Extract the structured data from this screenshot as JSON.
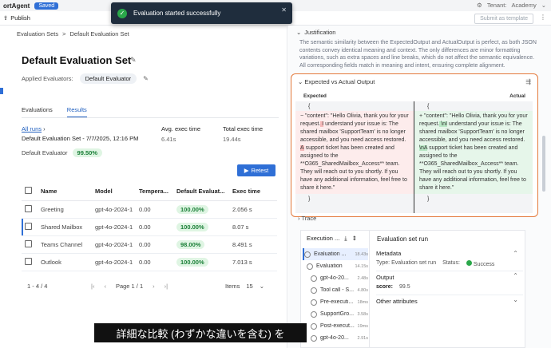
{
  "topbar": {
    "app": "ortAgent",
    "saved": "Saved",
    "tenant": "Tenant:",
    "tenant_name": "Academy"
  },
  "toolbar": {
    "publish": "Publish",
    "submit_template": "Submit as template"
  },
  "toast": {
    "message": "Evaluation started successfully"
  },
  "breadcrumb": {
    "root": "Evaluation Sets",
    "sep": ">",
    "current": "Default Evaluation Set"
  },
  "page": {
    "title": "Default Evaluation Set",
    "applied_label": "Applied Evaluators:",
    "evaluator_chip": "Default Evaluator"
  },
  "tabs": [
    {
      "label": "Evaluations"
    },
    {
      "label": "Results"
    }
  ],
  "run": {
    "all_runs": "All runs",
    "run_name": "Default Evaluation Set - 7/7/2025, 12:16 PM",
    "avg_label": "Avg. exec time",
    "avg_value": "6.41s",
    "total_label": "Total exec time",
    "total_value": "19.44s",
    "evaluator_label": "Default Evaluator",
    "evaluator_score": "99.50%"
  },
  "retest_label": "Retest",
  "table": {
    "headers": [
      "Name",
      "Model",
      "Tempera...",
      "Default Evaluat...",
      "Exec time"
    ],
    "rows": [
      {
        "name": "Greeting",
        "model": "gpt-4o-2024-1",
        "temp": "0.00",
        "score": "100.00%",
        "time": "2.056 s"
      },
      {
        "name": "Shared Mailbox",
        "model": "gpt-4o-2024-1",
        "temp": "0.00",
        "score": "100.00%",
        "time": "8.07 s"
      },
      {
        "name": "Teams Channel",
        "model": "gpt-4o-2024-1",
        "temp": "0.00",
        "score": "98.00%",
        "time": "8.491 s"
      },
      {
        "name": "Outlook",
        "model": "gpt-4o-2024-1",
        "temp": "0.00",
        "score": "100.00%",
        "time": "7.013 s"
      }
    ]
  },
  "pager": {
    "count": "1 - 4 / 4",
    "page": "Page 1 / 1",
    "items_label": "Items",
    "items_value": "15"
  },
  "justification": {
    "label": "Justification",
    "text": "The semantic similarity between the ExpectedOutput and ActualOutput is perfect, as both JSON contents convey identical meaning and context. The only differences are minor formatting variations, such as extra spaces and line breaks, which do not affect the semantic equivalence. All corresponding fields match in meaning and intent, ensuring complete alignment."
  },
  "diff": {
    "title": "Expected vs Actual Output",
    "expected_label": "Expected",
    "actual_label": "Actual",
    "open_brace": "{",
    "close_brace": "}",
    "expected_pre": "−  \"content\": \"Hello Olivia, thank you for your request.",
    "expected_hl": "  I",
    "expected_post": " understand your issue is: The shared mailbox 'SupportTeam' is no longer accessible, and you need access restored.",
    "expected_hl2": "  A",
    "expected_tail": " support ticket has been created and assigned to the **O365_SharedMailbox_Access** team. They will reach out to you shortly. If you have any additional information, feel free to share it here.\"",
    "actual_pre": "+  \"content\": \"Hello Olivia, thank you for your request.",
    "actual_hl": " \\nI",
    "actual_post": " understand your issue is: The shared mailbox 'SupportTeam' is no longer accessible, and you need access restored.",
    "actual_hl2": " \\nA",
    "actual_tail": " support ticket has been created and assigned to the **O365_SharedMailbox_Access** team. They will reach out to you shortly. If you have any additional information, feel free to share it here.\""
  },
  "trace": {
    "label": "Trace",
    "exec_title": "Execution ...",
    "items": [
      {
        "label": "Evaluation ...",
        "ms": "18.43s"
      },
      {
        "label": "Evaluation",
        "ms": "14.15s"
      },
      {
        "label": "gpt-4o-20...",
        "ms": "2.48s"
      },
      {
        "label": "Tool call - S...",
        "ms": "4.80s"
      },
      {
        "label": "Pre-executi...",
        "ms": "18ms"
      },
      {
        "label": "SupportGro...",
        "ms": "3.58s"
      },
      {
        "label": "Post-execut...",
        "ms": "19ms"
      },
      {
        "label": "gpt-4o-20...",
        "ms": "2.91s"
      }
    ],
    "run_title": "Evaluation set run",
    "metadata": "Metadata",
    "type_label": "Type: Evaluation set run",
    "status_label": "Status:",
    "status_value": "Success",
    "output": "Output",
    "score_label": "score:",
    "score_value": "99.5",
    "other": "Other attributes"
  },
  "subtitle": "詳細な比較 (わずかな違いを含む) を"
}
